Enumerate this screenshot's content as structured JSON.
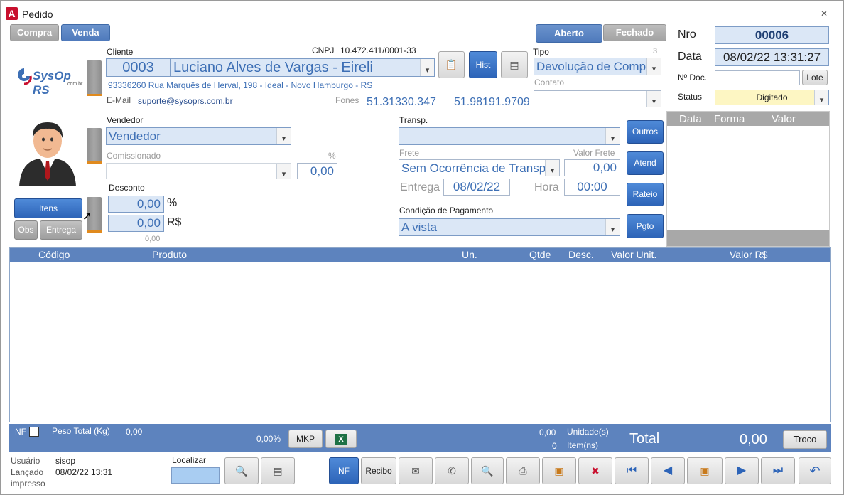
{
  "window": {
    "title": "Pedido",
    "close": "✕"
  },
  "tabs": {
    "compra": "Compra",
    "venda": "Venda",
    "aberto": "Aberto",
    "fechado": "Fechado"
  },
  "header": {
    "nro_label": "Nro",
    "nro_value": "00006",
    "data_label": "Data",
    "data_value": "08/02/22 13:31:27",
    "ndoc_label": "Nº Doc.",
    "ndoc_value": "",
    "lote_button": "Lote",
    "status_label": "Status",
    "status_value": "Digitado"
  },
  "logo": {
    "text": "SysOp RS",
    "sub": ".com.br"
  },
  "cliente": {
    "label": "Cliente",
    "codigo": "0003",
    "nome": "Luciano Alves de Vargas - Eireli",
    "cnpj_label": "CNPJ",
    "cnpj": "10.472.411/0001-33",
    "endereco": "93336260 Rua Marquês de Herval, 198 - Ideal - Novo Hamburgo - RS",
    "email_label": "E-Mail",
    "email": "suporte@sysoprs.com.br",
    "fones_label": "Fones",
    "fone1": "51.31330.347",
    "fone2": "51.98191.9709",
    "hist_button": "Hist"
  },
  "tipo": {
    "label": "Tipo",
    "num": "3",
    "value": "Devolução de Compra",
    "contato_label": "Contato",
    "contato_value": ""
  },
  "vendedor": {
    "label": "Vendedor",
    "value": "Vendedor",
    "comissionado_label": "Comissionado",
    "pct_label": "%",
    "pct_value": "0,00"
  },
  "desconto": {
    "label": "Desconto",
    "pct_value": "0,00",
    "pct_unit": "%",
    "rs_value": "0,00",
    "rs_unit": "R$",
    "total": "0,00"
  },
  "left_buttons": {
    "itens": "Itens",
    "obs": "Obs",
    "entrega": "Entrega"
  },
  "transp": {
    "label": "Transp.",
    "value": "",
    "frete_label": "Frete",
    "frete_value": "Sem Ocorrência de Transporte",
    "valor_frete_label": "Valor Frete",
    "valor_frete_value": "0,00",
    "entrega_label": "Entrega",
    "entrega_value": "08/02/22",
    "hora_label": "Hora",
    "hora_value": "00:00",
    "condicao_label": "Condição de Pagamento",
    "condicao_value": "A vista"
  },
  "side_buttons": {
    "outros": "Outros",
    "atend": "Atend",
    "rateio": "Rateio",
    "pgto": "Pgto"
  },
  "payments_grid": {
    "columns": [
      "Data",
      "Forma",
      "Valor"
    ]
  },
  "items_grid": {
    "columns": [
      "Código",
      "Produto",
      "Un.",
      "Qtde",
      "Desc.",
      "Valor Unit.",
      "Valor R$"
    ]
  },
  "totals": {
    "nf_label": "NF",
    "peso_label": "Peso Total (Kg)",
    "peso_value": "0,00",
    "pct_value": "0,00%",
    "mkp_button": "MKP",
    "unidades_value": "0,00",
    "unidades_label": "Unidade(s)",
    "itens_value": "0",
    "itens_label": "Item(ns)",
    "total_label": "Total",
    "total_value": "0,00",
    "troco_button": "Troco"
  },
  "footer": {
    "usuario_label": "Usuário",
    "usuario_value": "sisop",
    "lancado_label": "Lançado",
    "lancado_value": "08/02/22 13:31",
    "impresso_label": "impresso",
    "localizar_label": "Localizar",
    "nf_button": "NF",
    "recibo_button": "Recibo"
  },
  "colors": {
    "accent": "#3d6fb5",
    "grid_header": "#5d83be",
    "status_bg": "#fdf6c3"
  }
}
